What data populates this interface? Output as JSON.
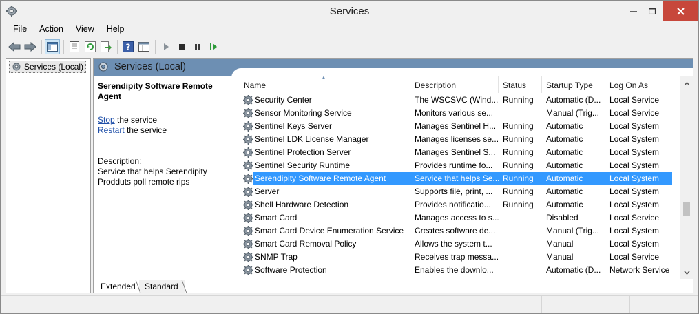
{
  "window": {
    "title": "Services",
    "controls": {
      "minimize": "minimize",
      "maximize": "maximize",
      "close": "close"
    }
  },
  "menu": [
    "File",
    "Action",
    "View",
    "Help"
  ],
  "toolbar": {
    "icons": [
      "back-arrow-icon",
      "forward-arrow-icon",
      "console-tree-icon",
      "properties-icon",
      "refresh-icon",
      "export-icon",
      "help-icon",
      "console-view-icon",
      "start-service-icon",
      "stop-service-icon",
      "pause-service-icon",
      "resume-service-icon"
    ]
  },
  "tree": {
    "root_label": "Services (Local)"
  },
  "content": {
    "header_title": "Services (Local)",
    "selected_name": "Serendipity Software Remote Agent",
    "action_stop_link": "Stop",
    "action_stop_rest": " the service",
    "action_restart_link": "Restart",
    "action_restart_rest": " the service",
    "description_label": "Description:",
    "description_text": "Service that helps Serendipity Prodduts poll remote rips"
  },
  "columns": {
    "name": "Name",
    "description": "Description",
    "status": "Status",
    "startup": "Startup Type",
    "logon": "Log On As"
  },
  "rows": [
    {
      "name": "Security Center",
      "description": "The WSCSVC (Wind...",
      "status": "Running",
      "startup": "Automatic (D...",
      "logon": "Local Service"
    },
    {
      "name": "Sensor Monitoring Service",
      "description": "Monitors various se...",
      "status": "",
      "startup": "Manual (Trig...",
      "logon": "Local Service"
    },
    {
      "name": "Sentinel Keys Server",
      "description": "Manages Sentinel H...",
      "status": "Running",
      "startup": "Automatic",
      "logon": "Local System"
    },
    {
      "name": "Sentinel LDK License Manager",
      "description": "Manages licenses se...",
      "status": "Running",
      "startup": "Automatic",
      "logon": "Local System"
    },
    {
      "name": "Sentinel Protection Server",
      "description": "Manages Sentinel S...",
      "status": "Running",
      "startup": "Automatic",
      "logon": "Local System"
    },
    {
      "name": "Sentinel Security Runtime",
      "description": "Provides runtime fo...",
      "status": "Running",
      "startup": "Automatic",
      "logon": "Local System"
    },
    {
      "name": "Serendipity Software Remote Agent",
      "description": "Service that helps Se...",
      "status": "Running",
      "startup": "Automatic",
      "logon": "Local System",
      "selected": true
    },
    {
      "name": "Server",
      "description": "Supports file, print, ...",
      "status": "Running",
      "startup": "Automatic",
      "logon": "Local System"
    },
    {
      "name": "Shell Hardware Detection",
      "description": "Provides notificatio...",
      "status": "Running",
      "startup": "Automatic",
      "logon": "Local System"
    },
    {
      "name": "Smart Card",
      "description": "Manages access to s...",
      "status": "",
      "startup": "Disabled",
      "logon": "Local Service"
    },
    {
      "name": "Smart Card Device Enumeration Service",
      "description": "Creates software de...",
      "status": "",
      "startup": "Manual (Trig...",
      "logon": "Local System"
    },
    {
      "name": "Smart Card Removal Policy",
      "description": "Allows the system t...",
      "status": "",
      "startup": "Manual",
      "logon": "Local System"
    },
    {
      "name": "SNMP Trap",
      "description": "Receives trap messa...",
      "status": "",
      "startup": "Manual",
      "logon": "Local Service"
    },
    {
      "name": "Software Protection",
      "description": "Enables the downlo...",
      "status": "",
      "startup": "Automatic (D...",
      "logon": "Network Service"
    }
  ],
  "tabs": {
    "extended": "Extended",
    "standard": "Standard"
  },
  "colors": {
    "header_blue": "#6d8fb3",
    "selection": "#3399ff",
    "close_red": "#c7473b",
    "link": "#1f4fa8"
  }
}
